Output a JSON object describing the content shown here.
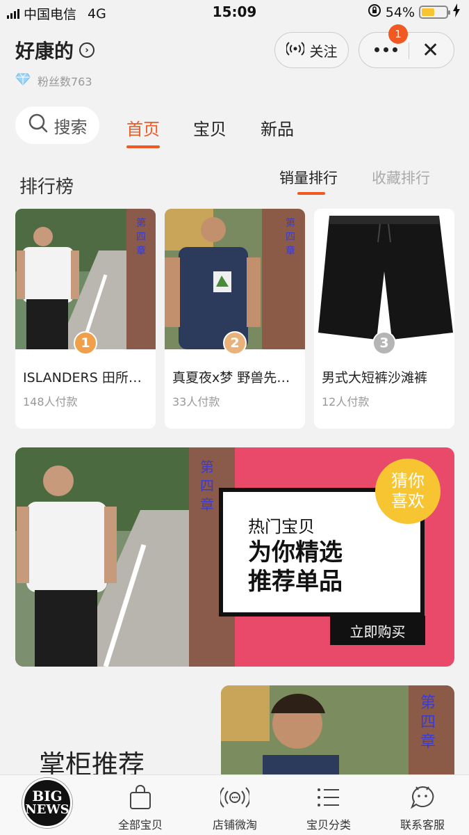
{
  "status_bar": {
    "carrier": "中国电信",
    "network": "4G",
    "time": "15:09",
    "battery": "54%",
    "battery_level": 0.54
  },
  "header": {
    "shop_name": "好康的",
    "fans_label": "粉丝数763",
    "follow_label": "关注",
    "badge_count": "1"
  },
  "search": {
    "label": "搜索"
  },
  "tabs": [
    {
      "label": "首页",
      "active": true
    },
    {
      "label": "宝贝",
      "active": false
    },
    {
      "label": "新品",
      "active": false
    }
  ],
  "ranking": {
    "title": "排行榜",
    "tabs": [
      {
        "label": "销量排行",
        "active": true
      },
      {
        "label": "收藏排行",
        "active": false
      }
    ],
    "items": [
      {
        "rank": "1",
        "title": "ISLANDERS 田所浩二同款T恤",
        "sales": "148人付款",
        "medal_color": "#f0a04b"
      },
      {
        "rank": "2",
        "title": "真夏夜x梦 野兽先辈同款",
        "sales": "33人付款",
        "medal_color": "#e8b27a"
      },
      {
        "rank": "3",
        "title": "男式大短裤沙滩裤",
        "sales": "12人付款",
        "medal_color": "#b5b5b5"
      }
    ]
  },
  "banner": {
    "subtitle": "热门宝贝",
    "line1": "为你精选",
    "line2": "推荐单品",
    "button": "立即购买",
    "guess_line1": "猜你",
    "guess_line2": "喜欢"
  },
  "recommend": {
    "title": "掌柜推荐"
  },
  "bottom_nav": [
    {
      "label": "全部宝贝",
      "icon": "bag-icon"
    },
    {
      "label": "店铺微淘",
      "icon": "broadcast-icon"
    },
    {
      "label": "宝贝分类",
      "icon": "list-icon"
    },
    {
      "label": "联系客服",
      "icon": "chat-icon"
    }
  ],
  "logo": {
    "line1": "BIG",
    "line2": "NEWS"
  },
  "colors": {
    "accent": "#f05a22",
    "banner_bg": "#e94a6a",
    "guess_bg": "#f7c531"
  }
}
